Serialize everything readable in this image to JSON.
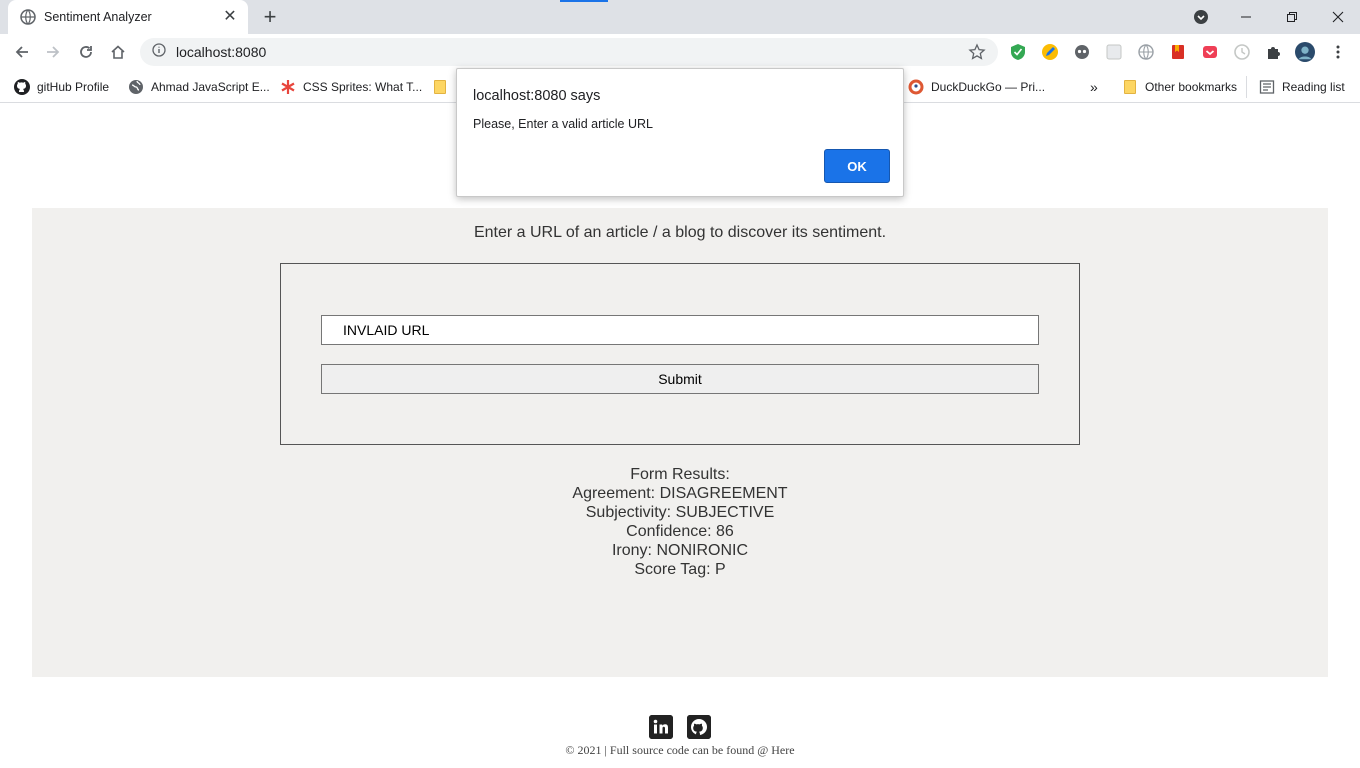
{
  "browser": {
    "tab": {
      "title": "Sentiment Analyzer"
    },
    "address": {
      "url": "localhost:8080"
    },
    "bookmarks": [
      {
        "label": "gitHub Profile"
      },
      {
        "label": "Ahmad JavaScript E..."
      },
      {
        "label": "CSS Sprites: What T..."
      },
      {
        "label": "DuckDuckGo — Pri..."
      }
    ],
    "bookmarks_overflow": "»",
    "other_bookmarks": "Other bookmarks",
    "reading_list": "Reading list"
  },
  "dialog": {
    "title": "localhost:8080 says",
    "message": "Please, Enter a valid article URL",
    "ok_label": "OK"
  },
  "page": {
    "instruction": "Enter a URL of an article / a blog to discover its sentiment.",
    "form": {
      "url_value": "INVLAID URL",
      "submit_label": "Submit"
    },
    "results": {
      "heading": "Form Results:",
      "agreement": "Agreement: DISAGREEMENT",
      "subjectivity": "Subjectivity: SUBJECTIVE",
      "confidence": "Confidence: 86",
      "irony": "Irony: NONIRONIC",
      "score_tag": "Score Tag: P"
    },
    "footer": {
      "copyright": "© 2021 | Full source code can be found @ Here"
    }
  },
  "colors": {
    "accent": "#1a73e8",
    "panel_bg": "#f1f0ee"
  }
}
